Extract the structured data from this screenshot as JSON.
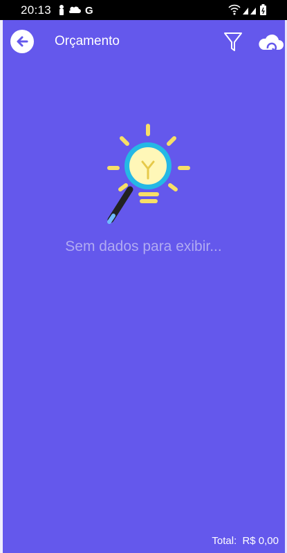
{
  "status_bar": {
    "time": "20:13",
    "left_icons": [
      "person-icon",
      "cloud-icon",
      "google-g-icon"
    ],
    "right_icons": [
      "wifi-icon",
      "signal-icon",
      "signal-icon",
      "battery-icon"
    ]
  },
  "app_bar": {
    "title": "Orçamento",
    "actions": [
      "filter-icon",
      "cloud-sync-icon"
    ]
  },
  "empty_state": {
    "message": "Sem dados para exibir...",
    "illustration": "lightbulb-magnifier-icon"
  },
  "footer": {
    "total_label": "Total:",
    "total_value": "R$ 0,00"
  },
  "colors": {
    "background": "#6458ec",
    "empty_text": "#b1abf2",
    "bulb_yellow": "#f7df67",
    "lens_blue": "#25b8e5"
  }
}
